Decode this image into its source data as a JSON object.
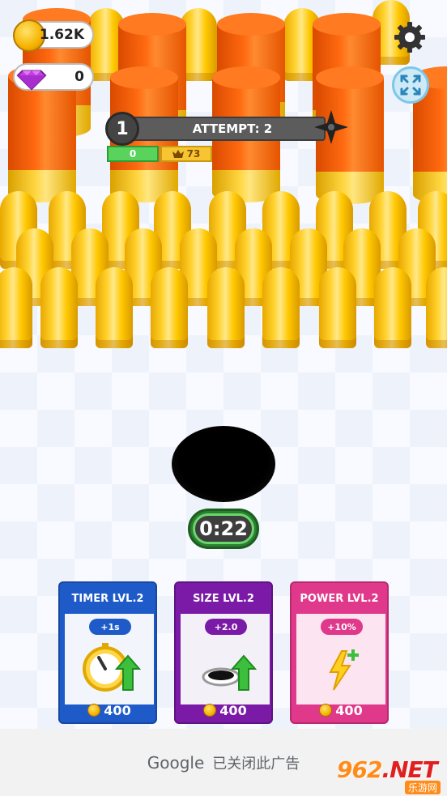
{
  "hud": {
    "coins": "1.62K",
    "gems": "0",
    "level": "1",
    "attempt_label": "ATTEMPT: 2",
    "score": "0",
    "best_score": "73"
  },
  "timer": "0:22",
  "cards": [
    {
      "title": "TIMER LVL.2",
      "bonus": "+1s",
      "price": "400",
      "icon": "stopwatch-icon"
    },
    {
      "title": "SIZE LVL.2",
      "bonus": "+2.0",
      "price": "400",
      "icon": "hole-icon"
    },
    {
      "title": "POWER LVL.2",
      "bonus": "+10%",
      "price": "400",
      "icon": "lightning-icon"
    }
  ],
  "ad": {
    "brand": "Google",
    "text": "已关闭此广告"
  },
  "watermark": {
    "main_a": "962",
    "main_b": ".NET",
    "sub": "乐游网"
  },
  "colors": {
    "timer_card": "#1e5bc8",
    "size_card": "#7a1aa6",
    "power_card": "#e0388a",
    "bullet_gold": "#ffc800",
    "shell_orange": "#ff6a10"
  }
}
